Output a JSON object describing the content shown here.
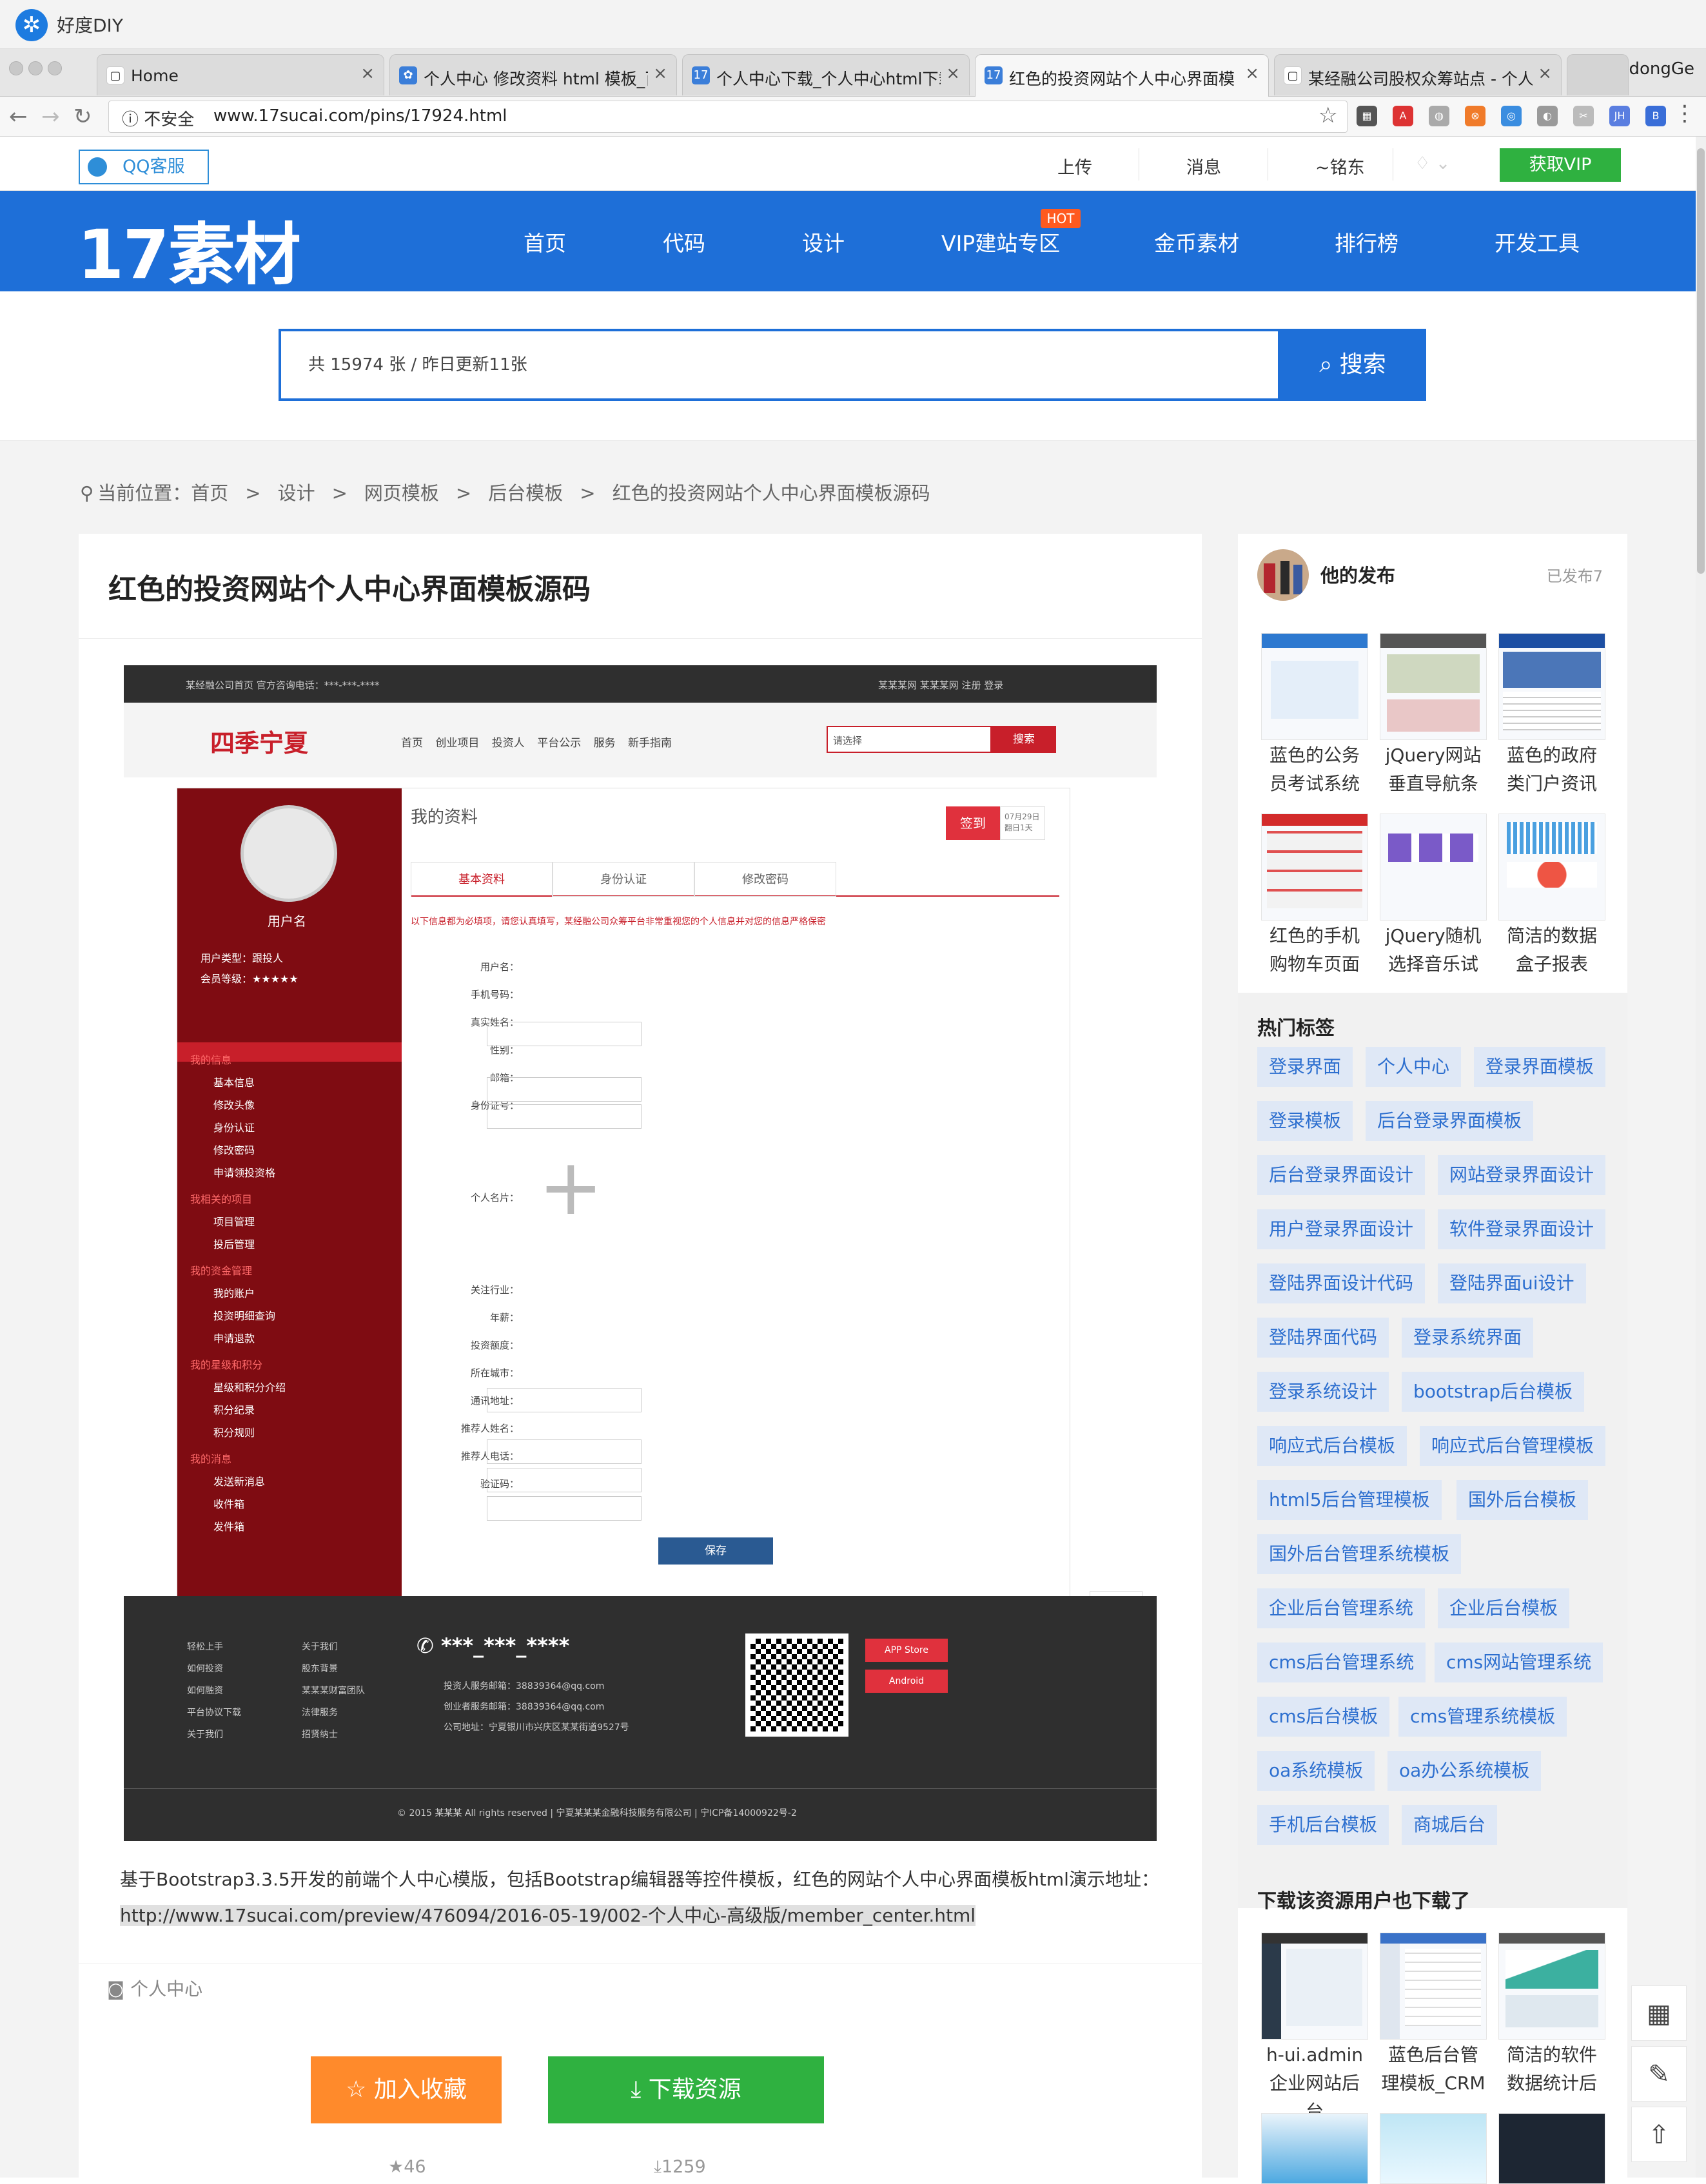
{
  "browser": {
    "app_title": "好度DIY",
    "tabs": [
      {
        "label": "Home",
        "active": false
      },
      {
        "label": "个人中心 修改资料 html 模板_百",
        "active": false
      },
      {
        "label": "个人中心下载_个人中心html下载",
        "active": false
      },
      {
        "label": "红色的投资网站个人中心界面模",
        "active": true
      },
      {
        "label": "某经融公司股权众筹站点 - 个人",
        "active": false
      }
    ],
    "profile_name": "dongGe",
    "security_label": "不安全",
    "url": "www.17sucai.com/pins/17924.html"
  },
  "site": {
    "qq_service": "QQ客服",
    "top_links": [
      "上传",
      "消息",
      "~铭东"
    ],
    "vip_button": "获取VIP",
    "logo": "17素材",
    "nav": [
      "首页",
      "代码",
      "设计",
      "VIP建站专区",
      "金币素材",
      "排行榜",
      "开发工具"
    ],
    "hot_badge": "HOT",
    "search_placeholder": "共 15974 张 / 昨日更新11张",
    "search_button": "搜索",
    "colors": {
      "brand_blue": "#1e6fd8",
      "green": "#2fb140",
      "orange": "#ff8a2b",
      "red": "#c81f2a"
    }
  },
  "breadcrumb": {
    "items": [
      "当前位置：首页",
      "设计",
      "网页模板",
      "后台模板",
      "红色的投资网站个人中心界面模板源码"
    ],
    "separator": ">"
  },
  "main": {
    "title": "红色的投资网站个人中心界面模板源码",
    "description": "基于Bootstrap3.3.5开发的前端个人中心模版，包括Bootstrap编辑器等控件模板，红色的网站个人中心界面模板html演示地址：",
    "demo_url": "http://www.17sucai.com/preview/476094/2016-05-19/002-个人中心-高级版/member_center.html",
    "tag": "个人中心",
    "fav_button": "加入收藏",
    "download_button": "下载资源",
    "fav_count": "46",
    "download_count": "1259"
  },
  "preview": {
    "topbar_left": "某经融公司首页    官方咨询电话：***-***-****",
    "topbar_right": "某某某网  某某某网  注册  登录",
    "logo": "四季宁夏",
    "nav": [
      "首页",
      "创业项目",
      "投资人",
      "平台公示",
      "服务",
      "新手指南"
    ],
    "select_label": "请选择",
    "search_btn": "搜索",
    "username": "用户名",
    "user_type": "用户类型：跟投人",
    "member_level": "会员等级：★★★★★",
    "menu": [
      "基本信息",
      "修改头像",
      "身份认证",
      "修改密码",
      "申请领投资格",
      "项目管理",
      "投后管理",
      "我的账户",
      "投资明细查询",
      "申请退款",
      "星级和积分介绍",
      "积分纪录",
      "积分规则",
      "发送新消息",
      "收件箱",
      "发件箱"
    ],
    "section_title": "我的资料",
    "sign_btn": "签到",
    "tabs": [
      "基本资料",
      "身份认证",
      "修改密码"
    ],
    "notice": "以下信息都为必填项，请您认真填写，某经融公司众筹平台非常重视您的个人信息并对您的信息严格保密",
    "fields": [
      "用户名：",
      "手机号码：",
      "真实姓名：",
      "性别：",
      "邮箱：",
      "身份证号：",
      "个人名片：",
      "关注行业：",
      "年薪：",
      "投资额度：",
      "所在城市：",
      "通讯地址：",
      "推荐人姓名：",
      "推荐人电话：",
      "验证码："
    ],
    "save_btn": "保存",
    "footer_phone": "***_***_****",
    "copyright": "© 2015 某某某 All rights reserved | 宁夏某某某金融科技服务有限公司 | 宁ICP备14000922号-2",
    "app_store": "APP Store",
    "android": "Android"
  },
  "sidebar": {
    "title": "他的发布",
    "count": "已发布7",
    "items": [
      "蓝色的公务员考试系统",
      "jQuery网站垂直导航条",
      "蓝色的政府类门户资讯",
      "红色的手机购物车页面",
      "jQuery随机选择音乐试",
      "简洁的数据盒子报表"
    ],
    "hot_title": "热门标签",
    "tags": [
      "登录界面",
      "个人中心",
      "登录界面模板",
      "登录模板",
      "后台登录界面模板",
      "后台登录界面设计",
      "网站登录界面设计",
      "用户登录界面设计",
      "软件登录界面设计",
      "登陆界面设计代码",
      "登陆界面ui设计",
      "登陆界面代码",
      "登录系统界面",
      "登录系统设计",
      "bootstrap后台模板",
      "响应式后台模板",
      "响应式后台管理模板",
      "html5后台管理模板",
      "国外后台模板",
      "国外后台管理系统模板",
      "企业后台管理系统",
      "企业后台模板",
      "cms后台管理系统",
      "cms网站管理系统",
      "cms后台模板",
      "cms管理系统模板",
      "oa系统模板",
      "oa办公系统模板",
      "手机后台模板",
      "商城后台"
    ],
    "also_title": "下载该资源用户也下载了",
    "also_items": [
      "h-ui.admin企业网站后台",
      "蓝色后台管理模板_CRM",
      "简洁的软件数据统计后"
    ]
  }
}
